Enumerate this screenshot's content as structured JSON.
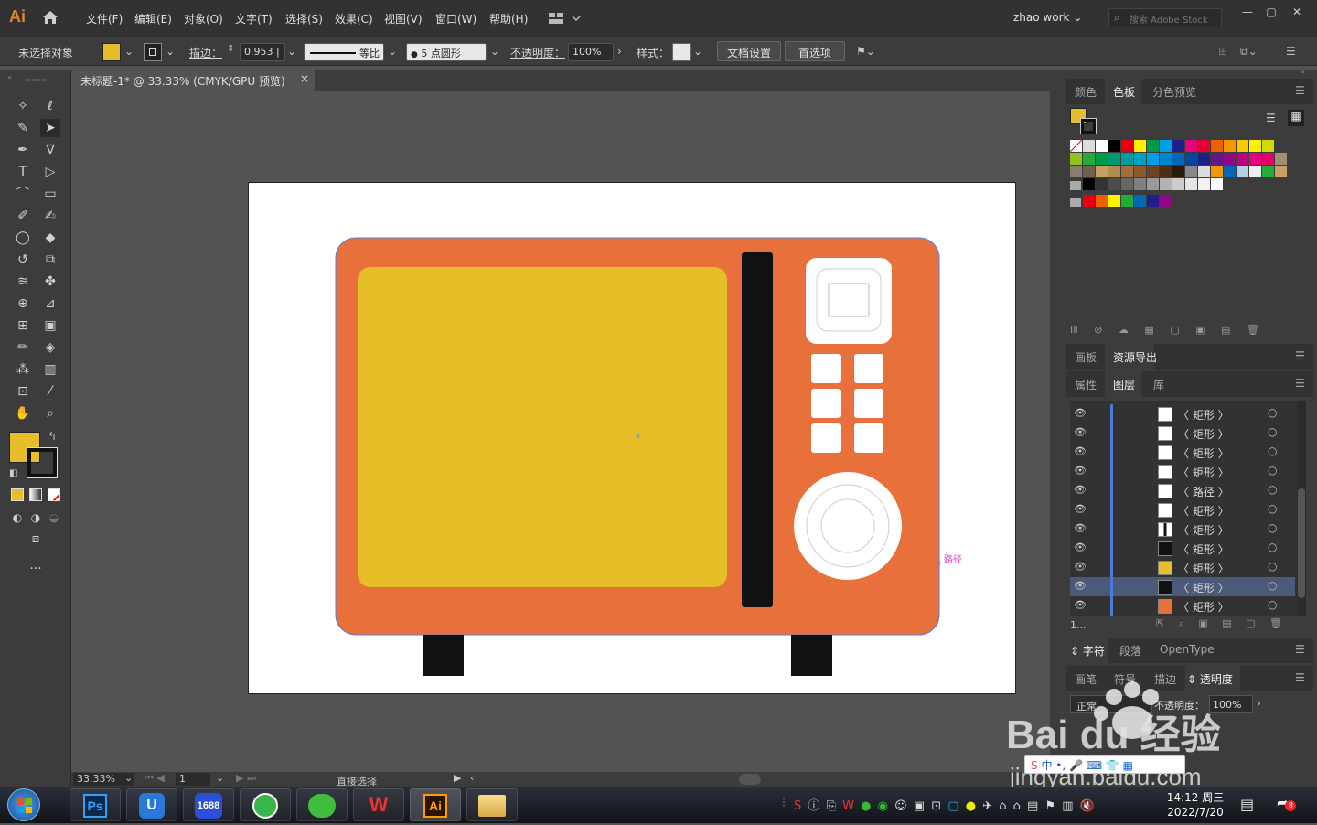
{
  "app": {
    "logo": "Ai",
    "workspace": "zhao work",
    "search_placeholder": "搜索 Adobe Stock"
  },
  "menu": [
    "文件(F)",
    "编辑(E)",
    "对象(O)",
    "文字(T)",
    "选择(S)",
    "效果(C)",
    "视图(V)",
    "窗口(W)",
    "帮助(H)"
  ],
  "control_bar": {
    "selection_status": "未选择对象",
    "stroke_label": "描边：",
    "stroke_weight": "0.953 |",
    "profile": "等比",
    "brush": "5 点圆形",
    "opacity_label": "不透明度：",
    "opacity_value": "100%",
    "style_label": "样式：",
    "doc_setup": "文档设置",
    "preferences": "首选项"
  },
  "document": {
    "tab_title": "未标题-1* @ 33.33% (CMYK/GPU 预览)",
    "close_glyph": "×"
  },
  "canvas": {
    "path_hint": "路径"
  },
  "statusbar": {
    "zoom": "33.33%",
    "artboard_num": "1",
    "current_tool": "直接选择"
  },
  "panels": {
    "swatch_tabs": [
      "颜色",
      "色板",
      "分色预览"
    ],
    "artboard_tabs": [
      "画板",
      "资源导出"
    ],
    "layer_tabs": [
      "属性",
      "图层",
      "库"
    ],
    "layers": [
      {
        "name": "〈 矩形 〉",
        "thumb": "#ffffff"
      },
      {
        "name": "〈 矩形 〉",
        "thumb": "#ffffff"
      },
      {
        "name": "〈 矩形 〉",
        "thumb": "#ffffff"
      },
      {
        "name": "〈 矩形 〉",
        "thumb": "#ffffff"
      },
      {
        "name": "〈 路径 〉",
        "thumb": "#ffffff"
      },
      {
        "name": "〈 矩形 〉",
        "thumb": "#ffffff"
      },
      {
        "name": "〈 矩形 〉",
        "thumb": "#ffffff"
      },
      {
        "name": "〈 矩形 〉",
        "thumb": "#111111"
      },
      {
        "name": "〈 矩形 〉",
        "thumb": "#e6c02a"
      },
      {
        "name": "〈 矩形 〉",
        "thumb": "#111111"
      },
      {
        "name": "〈 矩形 〉",
        "thumb": "#e8703a"
      }
    ],
    "layer_count": "1...",
    "char_tabs": [
      "字符",
      "段落",
      "OpenType"
    ],
    "bottom_tabs": [
      "画笔",
      "符号",
      "描边",
      "透明度"
    ],
    "blend_mode": "正常",
    "transparency_opacity_label": "不透明度：",
    "transparency_opacity_value": "100%"
  },
  "colors": {
    "fill": "#e6bd2a",
    "microwave_body": "#e8703a",
    "window": "#e6be28",
    "dark": "#111111",
    "selection": "#5b7ed8",
    "path_hint": "#e03ad8"
  },
  "taskbar": {
    "apps": [
      "Ps",
      "U",
      "1688",
      "360",
      "WeChat",
      "WPS",
      "Ai",
      "Explorer"
    ],
    "time": "14:12 周三",
    "date": "2022/7/20"
  },
  "watermark": {
    "brand": "Bai du 经验",
    "url": "jingyan.baidu.com"
  }
}
